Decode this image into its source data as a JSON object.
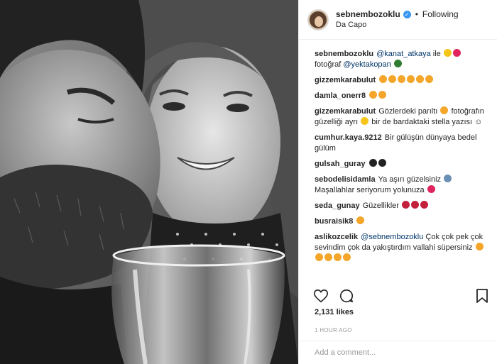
{
  "photo": {
    "alt": ""
  },
  "header": {
    "username": "sebnembozoklu",
    "verified_glyph": "✓",
    "separator": "•",
    "follow_label": "Following",
    "location": "Da Capo"
  },
  "comments": [
    {
      "user": "sebnembozoklu",
      "parts": [
        {
          "type": "mention",
          "text": "@kanat_atkaya"
        },
        {
          "type": "text",
          "text": " ile "
        },
        {
          "type": "emoji",
          "name": "star-emoji",
          "color": "#f5c518"
        },
        {
          "type": "emoji",
          "name": "heart-emoji",
          "color": "#e0245e"
        },
        {
          "type": "text",
          "text": " fotoğraf "
        },
        {
          "type": "mention",
          "text": "@yektakopan"
        },
        {
          "type": "text",
          "text": " "
        },
        {
          "type": "emoji",
          "name": "car-emoji",
          "color": "#2f7d32"
        }
      ]
    },
    {
      "user": "gizzemkarabulut",
      "parts": [
        {
          "type": "emoji",
          "name": "heart-eyes-emoji",
          "color": "#f4a62a"
        },
        {
          "type": "emoji",
          "name": "heart-eyes-emoji",
          "color": "#f4a62a"
        },
        {
          "type": "emoji",
          "name": "heart-eyes-emoji",
          "color": "#f4a62a"
        },
        {
          "type": "emoji",
          "name": "heart-eyes-emoji",
          "color": "#f4a62a"
        },
        {
          "type": "emoji",
          "name": "heart-eyes-emoji",
          "color": "#f4a62a"
        },
        {
          "type": "emoji",
          "name": "heart-eyes-emoji",
          "color": "#f4a62a"
        }
      ]
    },
    {
      "user": "damla_onerr8",
      "parts": [
        {
          "type": "emoji",
          "name": "heart-eyes-emoji",
          "color": "#f4a62a"
        },
        {
          "type": "emoji",
          "name": "heart-eyes-emoji",
          "color": "#f4a62a"
        }
      ]
    },
    {
      "user": "gizzemkarabulut",
      "parts": [
        {
          "type": "text",
          "text": "Gözlerdeki parıltı "
        },
        {
          "type": "emoji",
          "name": "heart-eyes-emoji",
          "color": "#f4a62a"
        },
        {
          "type": "text",
          "text": " fotoğrafın güzelliği ayrı "
        },
        {
          "type": "emoji",
          "name": "yellow-heart-emoji",
          "color": "#f5c518"
        },
        {
          "type": "text",
          "text": " bir de bardaktaki stella yazısı ☺"
        }
      ]
    },
    {
      "user": "cumhur.kaya.9212",
      "parts": [
        {
          "type": "text",
          "text": "Bir gülüşün dünyaya bedel gülüm"
        }
      ]
    },
    {
      "user": "gulsah_guray",
      "parts": [
        {
          "type": "emoji",
          "name": "black-heart-emoji",
          "color": "#222222"
        },
        {
          "type": "emoji",
          "name": "black-heart-emoji",
          "color": "#222222"
        }
      ]
    },
    {
      "user": "sebodelisidamla",
      "parts": [
        {
          "type": "text",
          "text": "Ya aşırı güzelsiniz "
        },
        {
          "type": "emoji",
          "name": "person-emoji",
          "color": "#6b8fb3"
        },
        {
          "type": "text",
          "text": " Maşallahlar seriyorum yolunuza "
        },
        {
          "type": "emoji",
          "name": "heart-emoji",
          "color": "#e0245e"
        }
      ]
    },
    {
      "user": "seda_gunay",
      "parts": [
        {
          "type": "text",
          "text": "Güzellikler "
        },
        {
          "type": "emoji",
          "name": "lips-emoji",
          "color": "#c3203b"
        },
        {
          "type": "emoji",
          "name": "lips-emoji",
          "color": "#c3203b"
        },
        {
          "type": "emoji",
          "name": "lips-emoji",
          "color": "#c3203b"
        }
      ]
    },
    {
      "user": "busraisik8",
      "parts": [
        {
          "type": "emoji",
          "name": "heart-eyes-emoji",
          "color": "#f4a62a"
        }
      ]
    },
    {
      "user": "aslikozcelik",
      "parts": [
        {
          "type": "mention",
          "text": "@sebnembozoklu"
        },
        {
          "type": "text",
          "text": " Çok çok pek çok sevindim çok da yakıştırdım vallahi süpersiniz "
        },
        {
          "type": "emoji",
          "name": "kiss-emoji",
          "color": "#f4a62a"
        },
        {
          "type": "emoji",
          "name": "kiss-emoji",
          "color": "#f4a62a"
        },
        {
          "type": "emoji",
          "name": "kiss-emoji",
          "color": "#f4a62a"
        },
        {
          "type": "emoji",
          "name": "kiss-emoji",
          "color": "#f4a62a"
        },
        {
          "type": "emoji",
          "name": "kiss-emoji",
          "color": "#f4a62a"
        }
      ]
    }
  ],
  "actions": {
    "like": "heart-icon",
    "comment": "comment-icon",
    "bookmark": "bookmark-icon"
  },
  "likes": "2,131 likes",
  "time": "1 HOUR AGO",
  "add_comment": {
    "placeholder": "Add a comment..."
  },
  "colors": {
    "link": "#003569",
    "verified": "#3897f0",
    "muted": "#999999",
    "border": "#efefef"
  }
}
